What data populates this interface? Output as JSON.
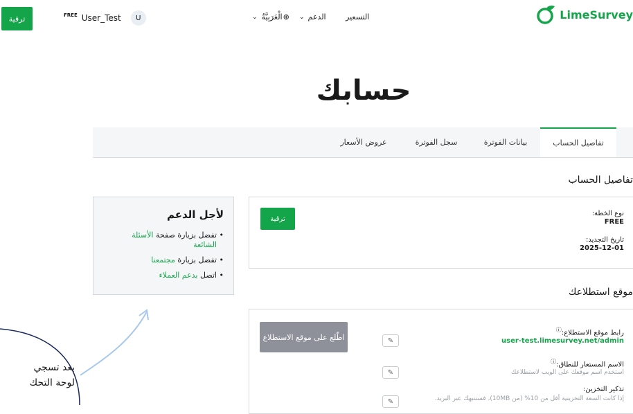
{
  "header": {
    "upgrade_label": "ترقية",
    "free_badge": "FREE",
    "username": "User_Test",
    "avatar_initial": "U",
    "language_label": "الْعَرَبِيَّةُ",
    "support_label": "الدعم",
    "pricing_label": "التسعير",
    "logo_text": "LimeSurvey"
  },
  "page_title": "حسابك",
  "tabs": [
    "تفاصيل الحساب",
    "بيانات الفوترة",
    "سجل الفوترة",
    "عروض الأسعار"
  ],
  "support": {
    "title": "لأجل الدعم",
    "item1_prefix": "تفضل بزيارة صفحة",
    "item1_link": "الأسئلة الشائعة",
    "item2_prefix": "تفضل بزيارة",
    "item2_link": "مجتمعنا",
    "item3_prefix": "اتصل",
    "item3_link": "بدعم العملاء"
  },
  "account": {
    "section_title": "تفاصيل الحساب",
    "plan_label": "نوع الخطة:",
    "plan_value": "FREE",
    "renewal_label": "تاريخ التجديد:",
    "renewal_value": "2025-12-01",
    "upgrade_label": "ترقية"
  },
  "survey_site": {
    "section_title": "موقع استطلاعك",
    "link_label": "رابط موقع الاستطلاع:",
    "link_value": "user-test.limesurvey.net/admin",
    "alias_label": "الاسم المستعار للنطاق:",
    "alias_hint": "استخدم اسم موقعك على الويب لاستطلاعك",
    "storage_label": "تذكير التخزين:",
    "storage_hint": "إذا كانت السعة التخزينية أقل من 10% (من 10MB)، فسننبهك عبر البريد.",
    "view_site_label": "اطّلع على موقع الاستطلاع"
  },
  "overlay": {
    "line1": "بعد تسجي",
    "line2": "لوحة التحك"
  },
  "colors": {
    "accent": "#14a54a",
    "panel": "#f4f6f8",
    "border": "#d5d9de",
    "grey_button": "#8e9199",
    "bubble_border": "#1a2a5e",
    "arrow": "#a9c8ef"
  }
}
